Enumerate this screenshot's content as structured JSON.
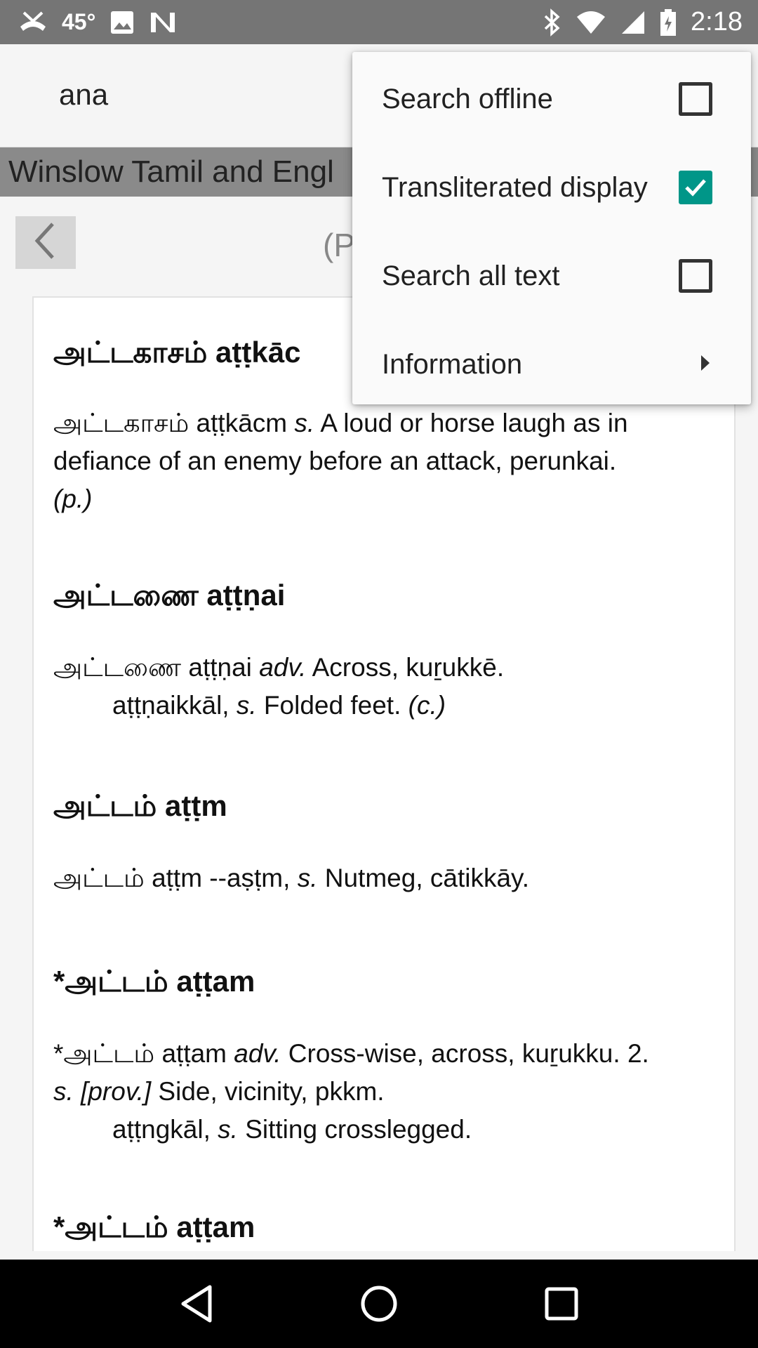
{
  "status_bar": {
    "temperature": "45°",
    "time": "2:18",
    "left_icons": [
      "missed-call-icon",
      "image-icon",
      "n-app-icon"
    ],
    "right_icons": [
      "bluetooth-icon",
      "wifi-icon",
      "signal-icon",
      "battery-icon"
    ]
  },
  "app_bar": {
    "search_text": "ana"
  },
  "dictionary_bar": {
    "title": "Winslow Tamil and Engl"
  },
  "nav": {
    "page_indicator": "(P"
  },
  "entries": [
    {
      "title": "அட்டகாசம் aṭṭkāc",
      "body_parts": {
        "a": "அட்டகாசம் aṭṭkācm ",
        "b": "s.",
        "c": " A loud or horse laugh as in defiance of an enemy before an attack, perunkai.",
        "d": "(p.)"
      }
    },
    {
      "title": "அட்டணை aṭṭṇai",
      "body_parts": {
        "a": "அட்டணை aṭṭṇai ",
        "b": "adv.",
        "c": " Across, kuṟukkē.",
        "sub_a": "aṭṭṇaikkāl, ",
        "sub_b": "s.",
        "sub_c": " Folded feet. ",
        "sub_d": "(c.)"
      }
    },
    {
      "title": "அட்டம் aṭṭm",
      "body_parts": {
        "a": "அட்டம் aṭṭm --aṣṭm, ",
        "b": "s.",
        "c": " Nutmeg, cātikkāy."
      }
    },
    {
      "title": "*அட்டம் aṭṭam",
      "body_parts": {
        "a": "*அட்டம் aṭṭam ",
        "b": "adv.",
        "c": " Cross-wise, across, kuṟukku. 2.",
        "d": "s. [prov.]",
        "e": " Side, vicinity, pkkm.",
        "sub_a": "aṭṭngkāl, ",
        "sub_b": "s.",
        "sub_c": " Sitting crosslegged."
      }
    },
    {
      "title": "*அட்டம் aṭṭam"
    }
  ],
  "menu": {
    "items": [
      {
        "label": "Search offline",
        "control": "checkbox",
        "checked": false
      },
      {
        "label": "Transliterated display",
        "control": "checkbox",
        "checked": true
      },
      {
        "label": "Search all text",
        "control": "checkbox",
        "checked": false
      },
      {
        "label": "Information",
        "control": "submenu-arrow"
      }
    ]
  },
  "navigation_bar": {
    "buttons": [
      "back-icon",
      "home-icon",
      "recents-icon"
    ]
  },
  "colors": {
    "status_bar": "#757575",
    "accent": "#009688",
    "dictionary_bar": "#8a8a8a",
    "nav_bar": "#000000"
  }
}
